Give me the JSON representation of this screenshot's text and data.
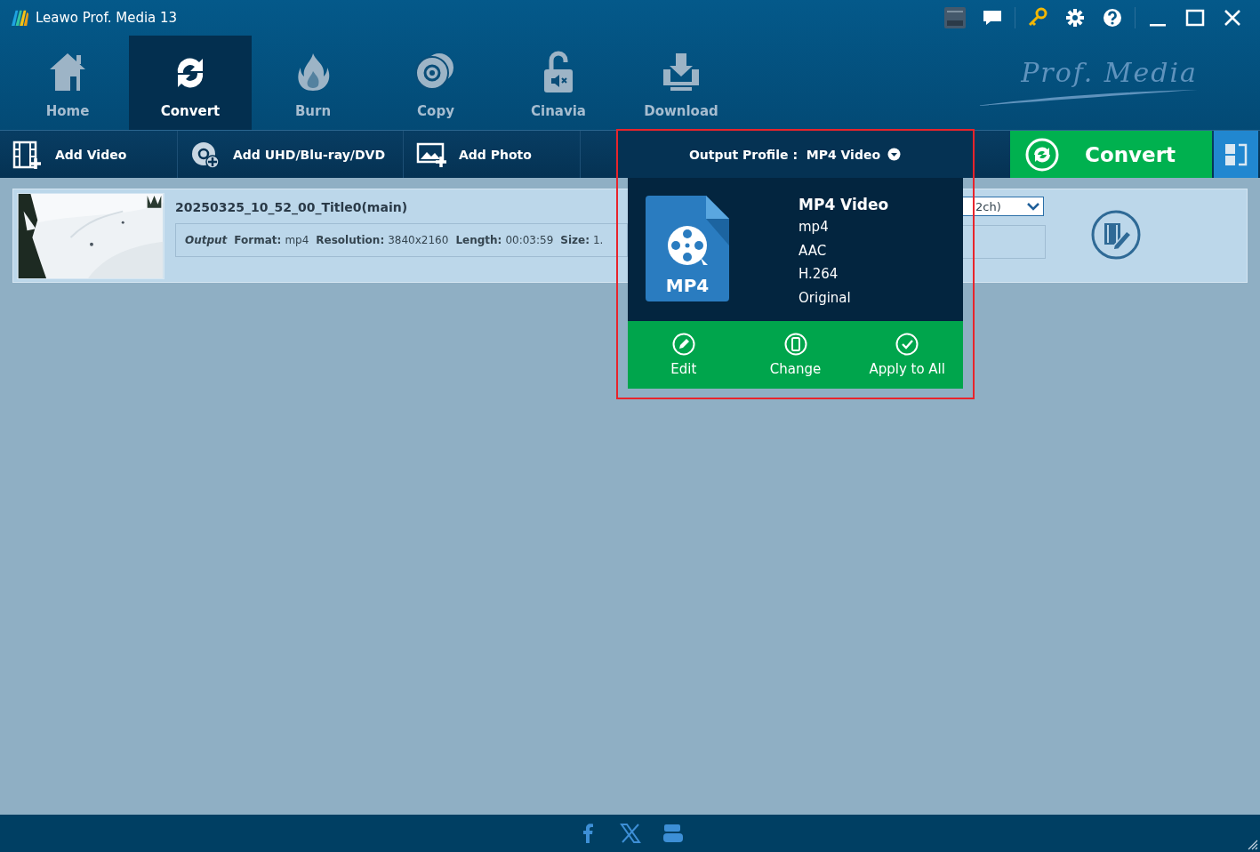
{
  "window": {
    "title": "Leawo Prof. Media 13"
  },
  "brand_logo": "Prof. Media",
  "tabs": [
    {
      "label": "Home",
      "selected": false
    },
    {
      "label": "Convert",
      "selected": true
    },
    {
      "label": "Burn",
      "selected": false
    },
    {
      "label": "Copy",
      "selected": false
    },
    {
      "label": "Cinavia",
      "selected": false
    },
    {
      "label": "Download",
      "selected": false
    }
  ],
  "toolbar": [
    {
      "label": "Add Video"
    },
    {
      "label": "Add UHD/Blu-ray/DVD"
    },
    {
      "label": "Add Photo"
    }
  ],
  "output_profile": {
    "label": "Output Profile :",
    "value": "MP4 Video"
  },
  "convert_button": "Convert",
  "file_item": {
    "title": "20250325_10_52_00_Title0(main)",
    "output_label": "Output",
    "fields": [
      {
        "name": "Format:",
        "value": "mp4"
      },
      {
        "name": "Resolution:",
        "value": "3840x2160"
      },
      {
        "name": "Length:",
        "value": "00:03:59"
      },
      {
        "name": "Size:",
        "value": "1."
      }
    ],
    "audio_select": "2ch)"
  },
  "profile_popup": {
    "badge": "MP4",
    "name": "MP4 Video",
    "details": [
      "mp4",
      "AAC",
      "H.264",
      "Original"
    ],
    "actions": [
      {
        "label": "Edit"
      },
      {
        "label": "Change"
      },
      {
        "label": "Apply to All"
      }
    ]
  }
}
